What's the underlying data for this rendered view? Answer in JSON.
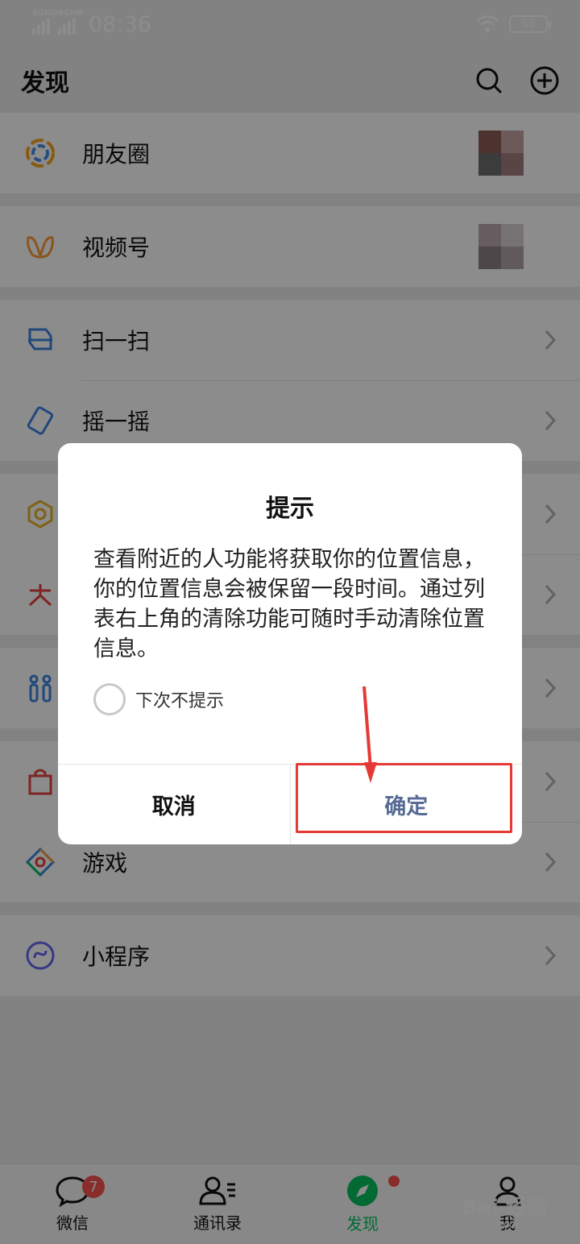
{
  "status": {
    "signal1": "4GHD",
    "signal2": "4GHD",
    "time": "08:36",
    "battery": "55"
  },
  "header": {
    "title": "发现"
  },
  "list": {
    "moments": "朋友圈",
    "channels": "视频号",
    "scan": "扫一扫",
    "shake": "摇一摇",
    "games": "游戏",
    "miniprograms": "小程序"
  },
  "dialog": {
    "title": "提示",
    "message": "查看附近的人功能将获取你的位置信息，你的位置信息会被保留一段时间。通过列表右上角的清除功能可随时手动清除位置信息。",
    "checkbox_label": "下次不提示",
    "cancel": "取消",
    "confirm": "确定"
  },
  "tabbar": {
    "chats": "微信",
    "chats_badge": "7",
    "contacts": "通讯录",
    "discover": "发现",
    "me": "我"
  },
  "watermark": {
    "brand": "Bai 经验",
    "url": "jingyan.baidu.com"
  },
  "colors": {
    "accent_green": "#07c160",
    "badge_red": "#fa5151",
    "link_blue": "#576b95",
    "highlight_red": "#e53935"
  }
}
